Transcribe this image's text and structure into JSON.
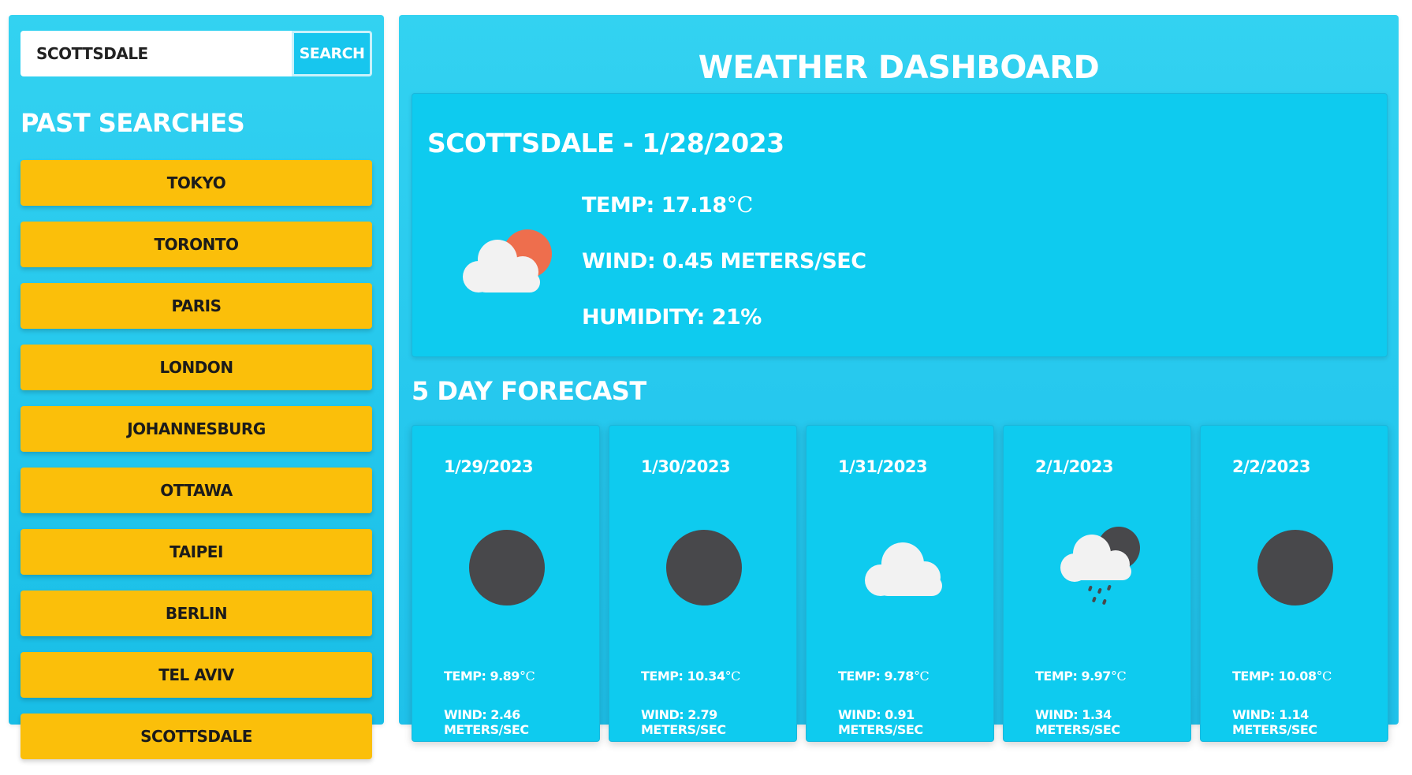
{
  "search": {
    "value": "SCOTTSDALE",
    "placeholder": "",
    "button_label": "SEARCH"
  },
  "past_searches": {
    "title": "PAST SEARCHES",
    "items": [
      "TOKYO",
      "TORONTO",
      "PARIS",
      "LONDON",
      "JOHANNESBURG",
      "OTTAWA",
      "TAIPEI",
      "BERLIN",
      "TEL AVIV",
      "SCOTTSDALE"
    ]
  },
  "dashboard": {
    "title": "WEATHER DASHBOARD"
  },
  "current": {
    "heading": "SCOTTSDALE - 1/28/2023",
    "icon": "partly-cloudy-day-icon",
    "temp_label": "TEMP: 17.18",
    "temp_unit": "°C",
    "wind": "WIND: 0.45 METERS/SEC",
    "humidity": "HUMIDITY: 21%"
  },
  "forecast": {
    "title": "5 DAY FORECAST",
    "days": [
      {
        "date": "1/29/2023",
        "icon": "clear-night-icon",
        "temp_label": "TEMP: 9.89",
        "temp_unit": "°C",
        "wind": "WIND: 2.46 METERS/SEC"
      },
      {
        "date": "1/30/2023",
        "icon": "clear-night-icon",
        "temp_label": "TEMP: 10.34",
        "temp_unit": "°C",
        "wind": "WIND: 2.79 METERS/SEC"
      },
      {
        "date": "1/31/2023",
        "icon": "cloud-icon",
        "temp_label": "TEMP: 9.78",
        "temp_unit": "°C",
        "wind": "WIND: 0.91 METERS/SEC"
      },
      {
        "date": "2/1/2023",
        "icon": "rain-night-icon",
        "temp_label": "TEMP: 9.97",
        "temp_unit": "°C",
        "wind": "WIND: 1.34 METERS/SEC"
      },
      {
        "date": "2/2/2023",
        "icon": "clear-night-icon",
        "temp_label": "TEMP: 10.08",
        "temp_unit": "°C",
        "wind": "WIND: 1.14 METERS/SEC"
      }
    ]
  },
  "colors": {
    "panel": "#29cbef",
    "card": "#0ecbef",
    "history_button": "#fbbf0a",
    "sun": "#ee6e4d",
    "moon": "#48484b",
    "cloud": "#f2f2f2"
  }
}
